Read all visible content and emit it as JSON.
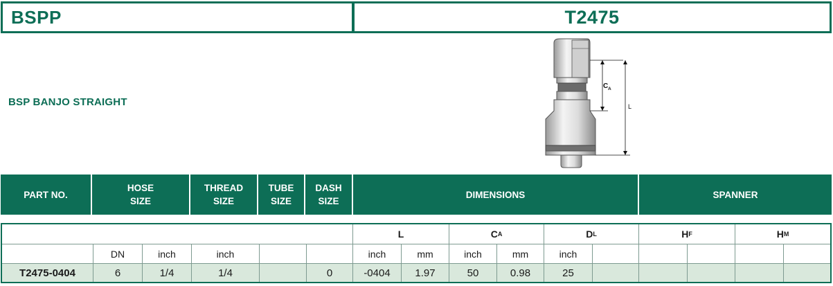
{
  "header": {
    "series": "BSPP",
    "part": "T2475"
  },
  "subtitle": "BSP BANJO STRAIGHT",
  "drawing": {
    "label_ca_main": "C",
    "label_ca_sub": "A",
    "label_l": "L"
  },
  "columns": {
    "part_no": "PART NO.",
    "hose_size": "HOSE\nSIZE",
    "thread_size": "THREAD\nSIZE",
    "tube_size": "TUBE\nSIZE",
    "dash_size": "DASH\nSIZE",
    "dimensions": "DIMENSIONS",
    "spanner": "SPANNER"
  },
  "dims": {
    "l": "L",
    "ca": "C",
    "ca_sub": "A",
    "dl": "D",
    "dl_sub": "L",
    "hf": "H",
    "hf_sub": "F",
    "hm": "H",
    "hm_sub": "M"
  },
  "units": [
    "DN",
    "inch",
    "inch",
    "inch",
    "mm",
    "inch",
    "mm",
    "inch"
  ],
  "row": {
    "part_no": "T2475-0404",
    "dn": "6",
    "hose_inch": "1/4",
    "thread_inch": "1/4",
    "tube": "",
    "dash": "0",
    "l_inch": "-0404",
    "l_mm": "1.97",
    "ca_inch": "50",
    "ca_mm": "0.98",
    "dl_inch": "25"
  },
  "colors": {
    "brand": "#0d6e56",
    "row_fill": "#d9e8dc"
  }
}
